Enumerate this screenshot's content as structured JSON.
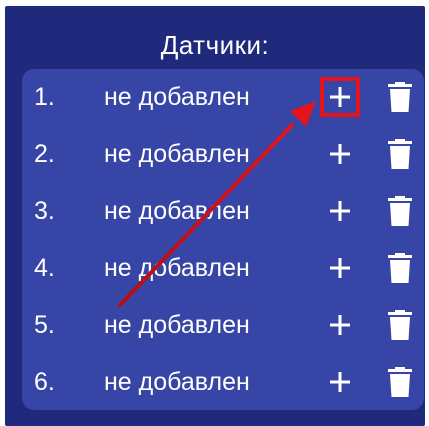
{
  "header": {
    "title": "Датчики:"
  },
  "sensors": [
    {
      "index": "1.",
      "status": "не добавлен"
    },
    {
      "index": "2.",
      "status": "не добавлен"
    },
    {
      "index": "3.",
      "status": "не добавлен"
    },
    {
      "index": "4.",
      "status": "не добавлен"
    },
    {
      "index": "5.",
      "status": "не добавлен"
    },
    {
      "index": "6.",
      "status": "не добавлен"
    }
  ],
  "icons": {
    "add": "plus-icon",
    "delete": "trash-icon"
  },
  "colors": {
    "background": "#1f2a7c",
    "list_background": "#3645a6",
    "text": "#ffffff",
    "highlight": "#e3141b"
  }
}
